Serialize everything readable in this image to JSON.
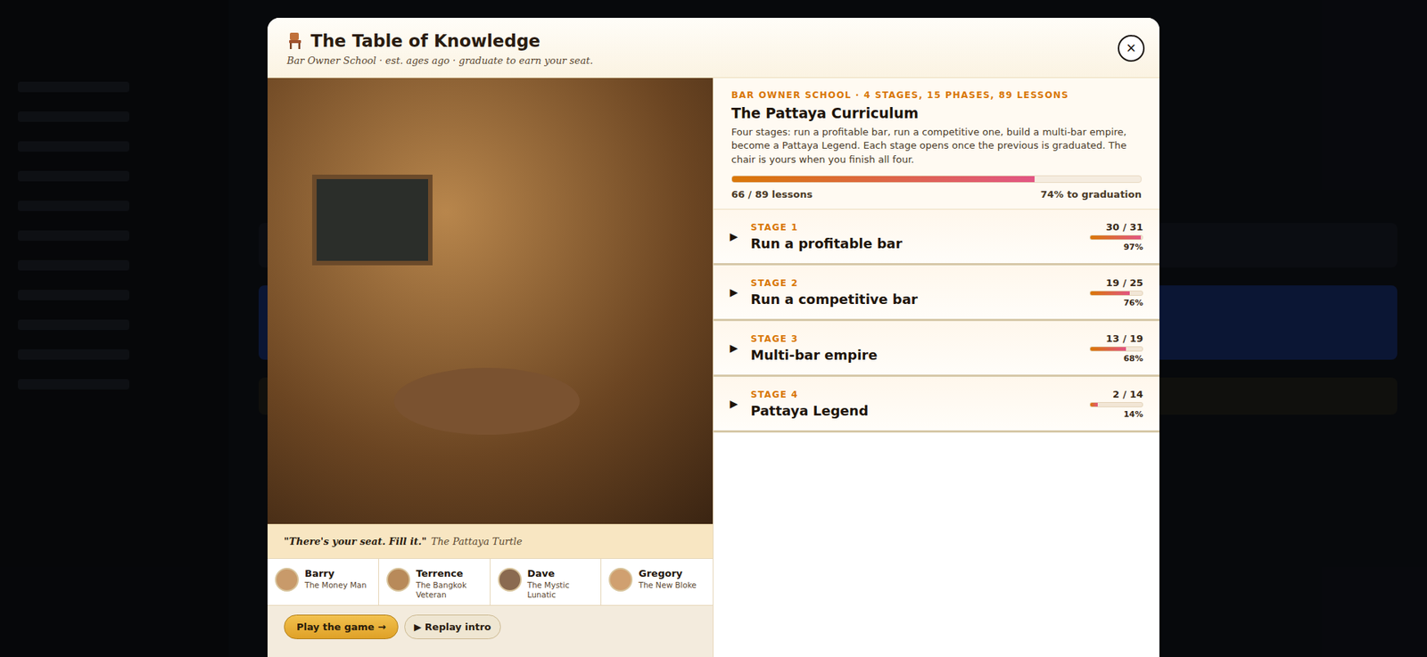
{
  "modal": {
    "title": "The Table of Knowledge",
    "subtitle": "Bar Owner School · est. ages ago · graduate to earn your seat.",
    "close": "×"
  },
  "quote": {
    "text": "\"There's your seat. Fill it.\"",
    "author": "The Pattaya Turtle"
  },
  "characters": [
    {
      "name": "Barry",
      "role": "The Money Man"
    },
    {
      "name": "Terrence",
      "role": "The Bangkok Veteran"
    },
    {
      "name": "Dave",
      "role": "The Mystic Lunatic"
    },
    {
      "name": "Gregory",
      "role": "The New Bloke"
    }
  ],
  "buttons": [
    {
      "label": "Play the game →",
      "kind": "primary"
    },
    {
      "label": "▶ Replay intro",
      "kind": "secondary"
    }
  ],
  "curriculum": {
    "eyebrow": "BAR OWNER SCHOOL · 4 STAGES, 15 PHASES, 89 LESSONS",
    "title": "The Pattaya Curriculum",
    "description": "Four stages: run a profitable bar, run a competitive one, build a multi-bar empire, become a Pattaya Legend. Each stage opens once the previous is graduated. The chair is yours when you finish all four.",
    "level": 0.74,
    "count": "66 / 89 lessons",
    "percent": "74% to graduation"
  },
  "stages": [
    {
      "label": "STAGE 1",
      "title": "Run a profitable bar",
      "count": "30 / 31",
      "percent": "97%",
      "level": 0.97,
      "expanded": false,
      "toggle": "▶"
    },
    {
      "label": "STAGE 2",
      "title": "Run a competitive bar",
      "count": "19 / 25",
      "percent": "76%",
      "level": 0.76,
      "expanded": false,
      "toggle": "▶"
    },
    {
      "label": "STAGE 3",
      "title": "Multi-bar empire",
      "count": "13 / 19",
      "percent": "68%",
      "level": 0.68,
      "expanded": false,
      "toggle": "▶"
    },
    {
      "label": "STAGE 4",
      "title": "Pattaya Legend",
      "count": "2 / 14",
      "percent": "14%",
      "level": 0.14,
      "expanded": false,
      "toggle": "▶"
    }
  ]
}
